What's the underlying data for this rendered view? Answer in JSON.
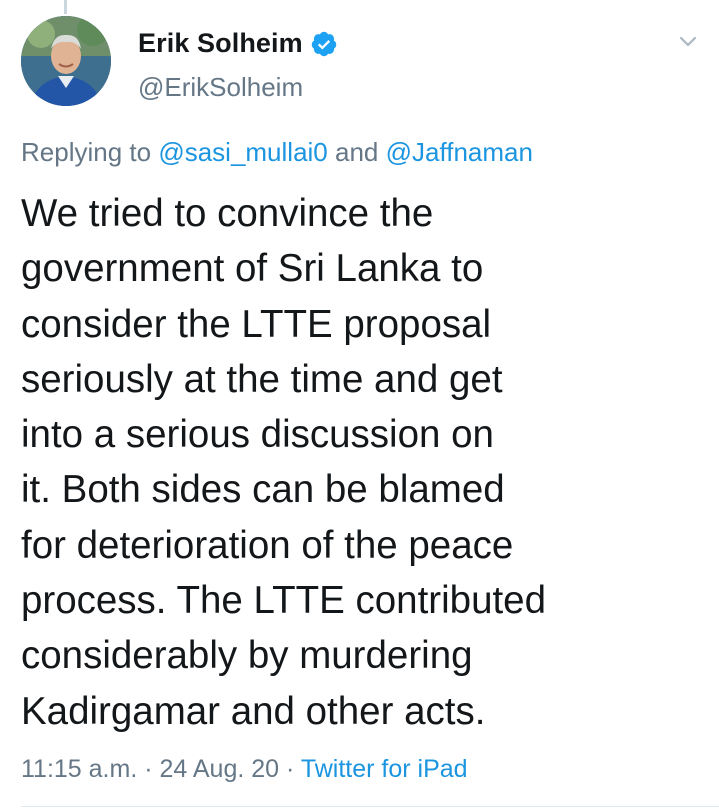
{
  "author": {
    "display_name": "Erik Solheim",
    "handle": "@ErikSolheim",
    "verified": true,
    "avatar_icon": "profile-photo"
  },
  "reply": {
    "prefix": "Replying to ",
    "users": [
      "@sasi_mullai0",
      "@Jaffnaman"
    ],
    "joiner": " and "
  },
  "tweet": {
    "lines": [
      "We tried to convince the",
      "government of Sri Lanka to",
      "consider the LTTE proposal",
      "seriously at the time and get",
      "into a serious discussion on",
      "it. Both sides can be blamed",
      "for deterioration of the peace",
      "process. The LTTE contributed",
      "considerably by murdering",
      "Kadirgamar and other acts."
    ]
  },
  "meta": {
    "time": "11:15 a.m.",
    "separator": " · ",
    "date": "24 Aug. 20",
    "source": "Twitter for iPad"
  },
  "colors": {
    "link": "#1b95e0",
    "secondary_text": "#657786",
    "verified_badge": "#1da1f2"
  },
  "icons": {
    "verified": "verified-badge-icon",
    "more": "chevron-down-icon"
  }
}
